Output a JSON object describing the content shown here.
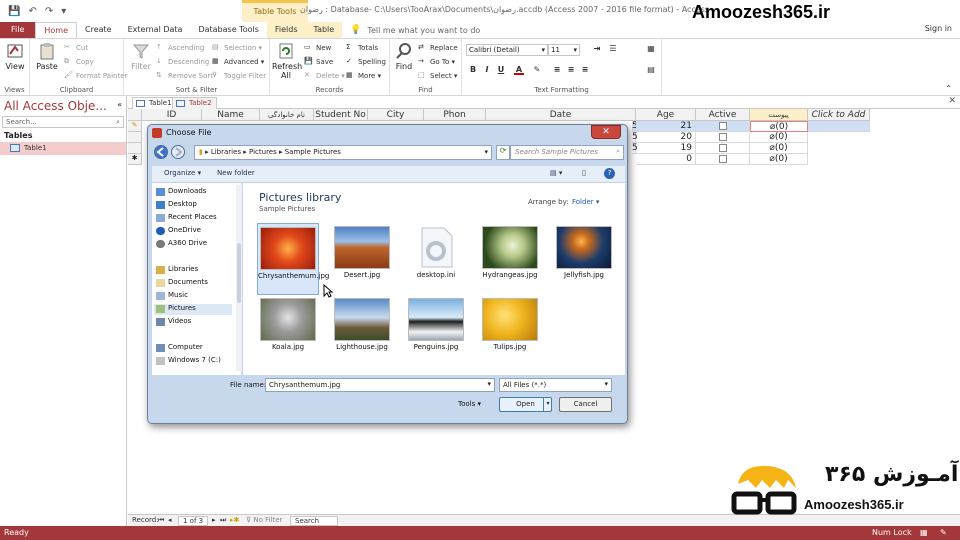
{
  "window": {
    "title": "رضوان : Database- C:\\Users\\TooArax\\Documents\\رضوان.accdb (Access 2007 - 2016 file format) - Access",
    "context_group": "Table Tools",
    "sign_in": "Sign in"
  },
  "watermark": "Amoozesh365.ir",
  "tabs": [
    "File",
    "Home",
    "Create",
    "External Data",
    "Database Tools",
    "Fields",
    "Table"
  ],
  "tell_me": "Tell me what you want to do",
  "ribbon": {
    "views": {
      "name": "Views",
      "view": "View"
    },
    "clipboard": {
      "name": "Clipboard",
      "paste": "Paste",
      "cut": "Cut",
      "copy": "Copy",
      "format_painter": "Format Painter"
    },
    "sort_filter": {
      "name": "Sort & Filter",
      "filter": "Filter",
      "ascending": "Ascending",
      "descending": "Descending",
      "remove_sort": "Remove Sort",
      "selection": "Selection",
      "advanced": "Advanced",
      "toggle_filter": "Toggle Filter"
    },
    "records": {
      "name": "Records",
      "refresh": "Refresh",
      "refresh_all": "All",
      "new": "New",
      "save": "Save",
      "delete": "Delete",
      "totals": "Totals",
      "spelling": "Spelling",
      "more": "More"
    },
    "find": {
      "name": "Find",
      "find": "Find",
      "replace": "Replace",
      "go_to": "Go To",
      "select": "Select"
    },
    "text_formatting": {
      "name": "Text Formatting",
      "font": "Calibri (Detail)",
      "size": "11",
      "bold": "B",
      "italic": "I",
      "underline": "U",
      "font_color": "A"
    }
  },
  "nav_pane": {
    "title": "All Access Obje...",
    "search": "Search...",
    "section": "Tables",
    "item": "Table1"
  },
  "object_tabs": [
    "Table1",
    "Table2"
  ],
  "datasheet": {
    "columns": [
      "ID",
      "Name",
      "نام خانوادگی",
      "Student No",
      "City",
      "Phon",
      "Date",
      "Age",
      "Active",
      "پیوست",
      "Click to Add"
    ],
    "rows": [
      {
        "id_tail": "5",
        "age": "21",
        "attach": "(0)"
      },
      {
        "id_tail": "5",
        "age": "20",
        "attach": "(0)"
      },
      {
        "id_tail": "5",
        "age": "19",
        "attach": "(0)"
      },
      {
        "id_tail": "",
        "age": "0",
        "attach": "(0)"
      }
    ]
  },
  "dialog": {
    "title": "Choose File",
    "close": "✕",
    "address": [
      "Libraries",
      "Pictures",
      "Sample Pictures"
    ],
    "search_placeholder": "Search Sample Pictures",
    "organize": "Organize ▾",
    "new_folder": "New folder",
    "library_title": "Pictures library",
    "library_subtitle": "Sample Pictures",
    "arrange_by": "Arrange by:",
    "arrange_value": "Folder ▾",
    "nav_items": [
      "Downloads",
      "Desktop",
      "Recent Places",
      "OneDrive",
      "A360 Drive",
      "Libraries",
      "Documents",
      "Music",
      "Pictures",
      "Videos",
      "Computer",
      "Windows 7 (C:)"
    ],
    "files": [
      "Chrysanthemum.jpg",
      "Desert.jpg",
      "desktop.ini",
      "Hydrangeas.jpg",
      "Jellyfish.jpg",
      "Koala.jpg",
      "Lighthouse.jpg",
      "Penguins.jpg",
      "Tulips.jpg"
    ],
    "file_name_label": "File name:",
    "file_name_value": "Chrysanthemum.jpg",
    "file_type": "All Files (*.*)",
    "tools": "Tools",
    "open": "Open",
    "cancel": "Cancel"
  },
  "record_nav": {
    "label": "Record:",
    "position": "1 of 3",
    "filter": "No Filter",
    "search": "Search"
  },
  "status": {
    "left": "Ready",
    "right": "Num Lock"
  },
  "brand": {
    "text": "Amoozesh365.ir",
    "fa": "آمـوزش ۳۶۵"
  },
  "colors": {
    "access_red": "#a4373a",
    "dialog_blue": "#c7d8ec",
    "selection_pink": "#f4cccc"
  }
}
